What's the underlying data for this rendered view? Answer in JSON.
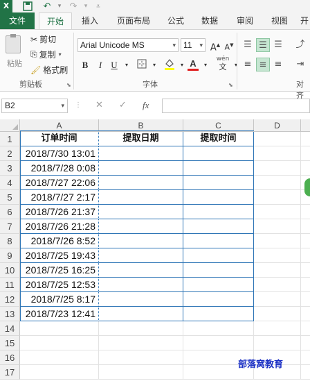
{
  "app": {
    "logo": "X"
  },
  "quick_access": {
    "save_icon": "save-icon",
    "undo_icon": "undo-icon",
    "redo_icon": "redo-icon"
  },
  "tabs": [
    {
      "label": "文件"
    },
    {
      "label": "开始"
    },
    {
      "label": "插入"
    },
    {
      "label": "页面布局"
    },
    {
      "label": "公式"
    },
    {
      "label": "数据"
    },
    {
      "label": "审阅"
    },
    {
      "label": "视图"
    },
    {
      "label": "开"
    }
  ],
  "ribbon": {
    "clipboard": {
      "paste_label": "粘贴",
      "cut_label": "剪切",
      "copy_label": "复制",
      "format_painter_label": "格式刷",
      "group_label": "剪贴板"
    },
    "font": {
      "font_name": "Arial Unicode MS",
      "font_size": "11",
      "group_label": "字体",
      "bold": "B",
      "italic": "I",
      "underline": "U",
      "grow": "A",
      "shrink": "A",
      "font_color_letter": "A",
      "wen": "wén",
      "wen_char": "文"
    },
    "alignment": {
      "group_label": "对齐"
    }
  },
  "formula_bar": {
    "name_box": "B2",
    "fx": "fx",
    "cancel": "✕",
    "enter": "✓",
    "value": ""
  },
  "columns": [
    "A",
    "B",
    "C",
    "D"
  ],
  "rows": [
    "1",
    "2",
    "3",
    "4",
    "5",
    "6",
    "7",
    "8",
    "9",
    "10",
    "11",
    "12",
    "13",
    "14",
    "15",
    "16",
    "17"
  ],
  "table": {
    "headers": [
      "订单时间",
      "提取日期",
      "提取时间"
    ],
    "order_times": [
      "2018/7/30 13:01",
      "2018/7/28 0:08",
      "2018/7/27 22:06",
      "2018/7/27 2:17",
      "2018/7/26 21:37",
      "2018/7/26 21:28",
      "2018/7/26 8:52",
      "2018/7/25 19:43",
      "2018/7/25 16:25",
      "2018/7/25 12:53",
      "2018/7/25 8:17",
      "2018/7/23 12:41"
    ]
  },
  "watermark": "部落窝教育",
  "colors": {
    "excel_green": "#217346",
    "table_border": "#2e75b6",
    "watermark": "#1a2fc4"
  }
}
